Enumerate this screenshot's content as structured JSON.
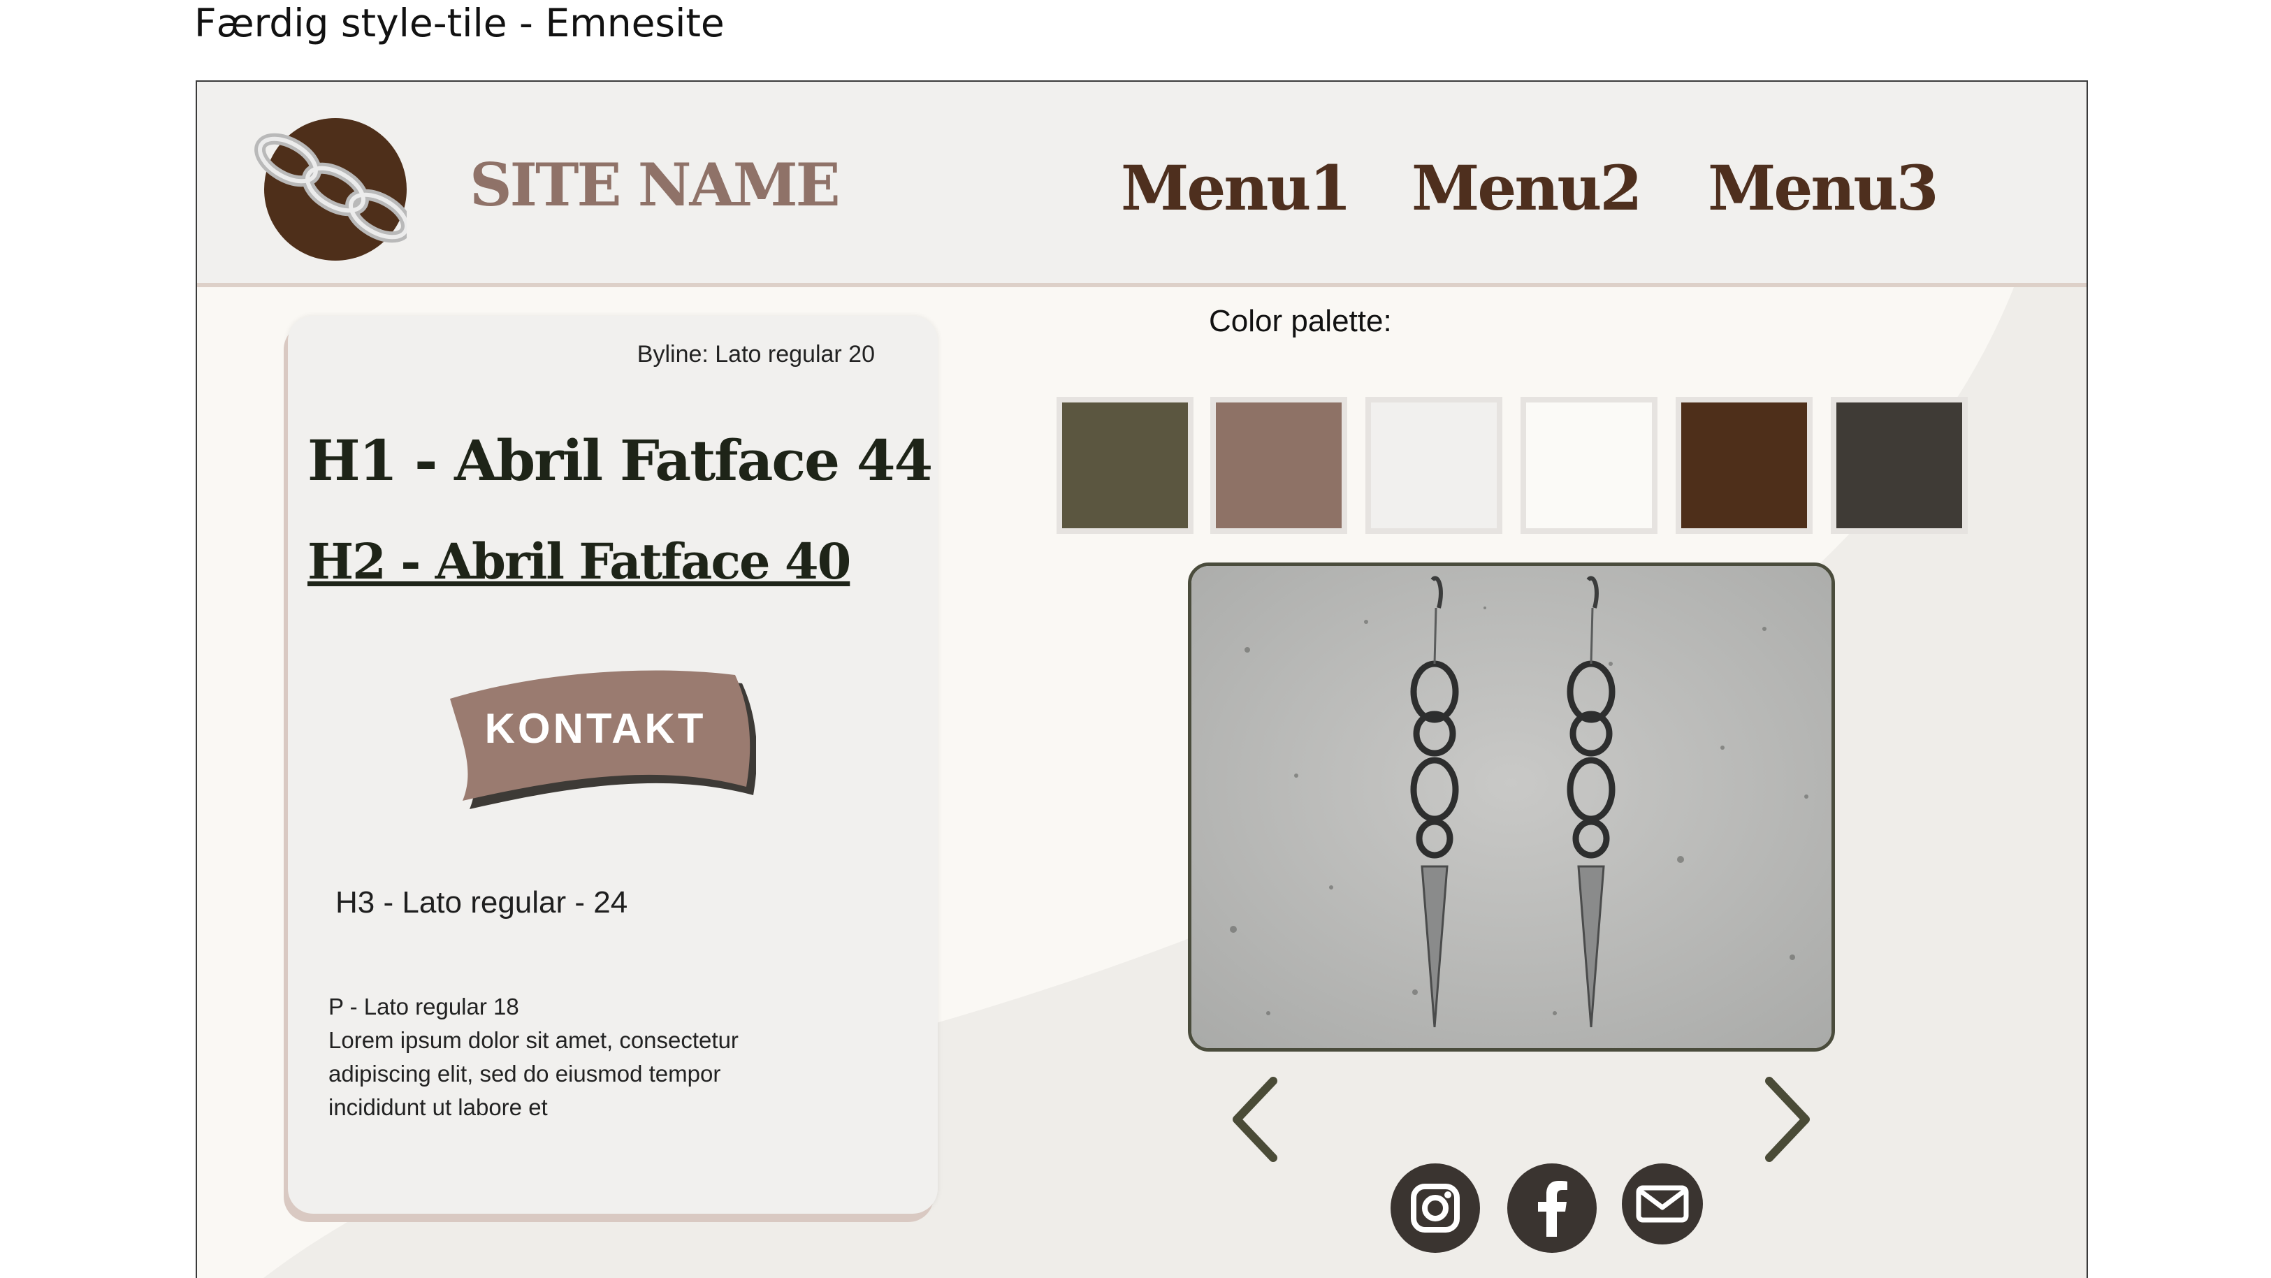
{
  "caption": "Færdig style-tile - Emnesite",
  "header": {
    "site_name": "SITE NAME",
    "menu": [
      "Menu1",
      "Menu2",
      "Menu3"
    ]
  },
  "card": {
    "byline": "Byline: Lato regular 20",
    "h1": "H1 - Abril Fatface 44",
    "h2": "H2 - Abril Fatface 40",
    "button_label": "KONTAKT",
    "h3": "H3 - Lato regular - 24",
    "paragraph_label": "P - Lato regular 18",
    "paragraph_lines": [
      " Lorem ipsum dolor sit amet, consectetur",
      "adipiscing elit, sed do eiusmod tempor",
      "incididunt ut labore et"
    ]
  },
  "palette": {
    "label": "Color palette:",
    "colors": [
      "#5b5640",
      "#8e7266",
      "#f1f0ee",
      "#fbfaf7",
      "#4e2f1a",
      "#3f3b36"
    ]
  },
  "colors": {
    "header_bg": "#f1f0ee",
    "brand_brown": "#4e2f1e",
    "accent_rose": "#8f7268",
    "frame_bg": "#faf8f4",
    "curve": "#efede9",
    "icon_dark": "#3a3430"
  },
  "icons": {
    "logo": "chain-links-logo",
    "prev": "chevron-left-icon",
    "next": "chevron-right-icon",
    "social": [
      "instagram-icon",
      "facebook-icon",
      "mail-icon"
    ]
  }
}
